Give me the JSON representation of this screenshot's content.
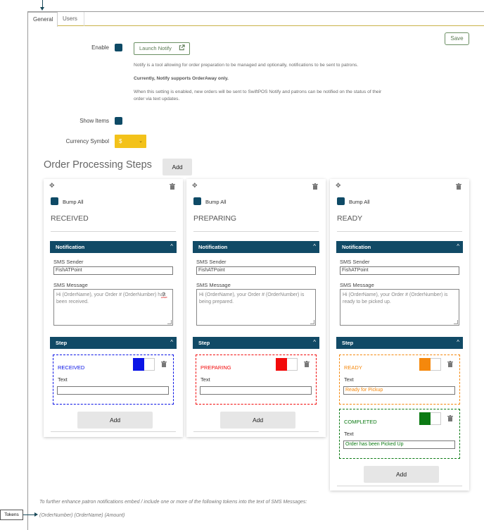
{
  "tabs": [
    {
      "label": "General"
    },
    {
      "label": "Users"
    }
  ],
  "toolbar": {
    "save_label": "Save"
  },
  "settings": {
    "enable_label": "Enable",
    "launch_label": "Launch Notify",
    "desc1": "Notify is a tool allowing for order preparation to be managed and optionally, notifications to be sent to patrons.",
    "desc2": "Currently, Notify supports OrderAway only.",
    "desc3a": "When this setting is enabled, new orders will be sent to SwiftPOS Notify and patrons can be notified on the status of their",
    "desc3b": "order via text updates.",
    "show_items_label": "Show Items",
    "currency_label": "Currency Symbol",
    "currency_value": "$"
  },
  "steps_section": {
    "title": "Order Processing Steps",
    "add_label": "Add"
  },
  "common": {
    "bump_all": "Bump All",
    "notification": "Notification",
    "sms_sender": "SMS Sender",
    "sms_message": "SMS Message",
    "step": "Step",
    "text": "Text",
    "add": "Add"
  },
  "cards": [
    {
      "title": "RECEIVED",
      "sender": "FishATPoint",
      "message": "Hi (OrderName), your Order # (OrderNumber) has been received.",
      "steps": [
        {
          "name": "RECEIVED",
          "color": "#0a14e6",
          "text": ""
        }
      ]
    },
    {
      "title": "PREPARING",
      "sender": "FishATPoint",
      "message": "Hi (OrderName), your Order # (OrderNumber) is being prepared.",
      "steps": [
        {
          "name": "PREPARING",
          "color": "#f20a0a",
          "text": ""
        }
      ]
    },
    {
      "title": "READY",
      "sender": "FishATPoint",
      "message": "Hi (OrderName), your Order # (OrderNumber) is ready to be picked up.",
      "steps": [
        {
          "name": "READY",
          "color": "#f5880c",
          "text": "Ready for Pickup"
        },
        {
          "name": "COMPLETED",
          "color": "#0c7a14",
          "text": "Order has been Picked Up"
        }
      ]
    }
  ],
  "footer": {
    "note": "To further enhance patron notifications embed / include one or more of the following tokens into the text of SMS Messages:",
    "tokens": "(OrderNumber) (OrderName) (Amount)",
    "tokens_badge": "Tokens"
  },
  "colors": {
    "accent": "#114a66",
    "currency_bg": "#f3c21a",
    "tab_underline": "#c9b24a"
  }
}
